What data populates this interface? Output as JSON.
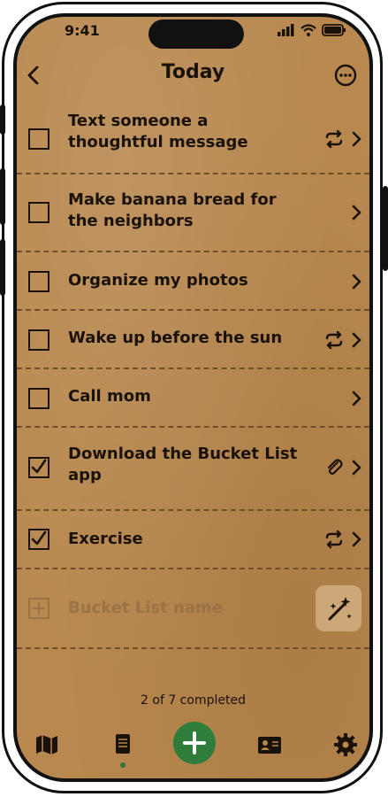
{
  "status_bar": {
    "time": "9:41"
  },
  "header": {
    "title": "Today"
  },
  "tasks": [
    {
      "label": "Text someone a thoughtful message",
      "checked": false,
      "icons": [
        "repeat-icon",
        "chevron-right-icon"
      ]
    },
    {
      "label": "Make banana bread for the neighbors",
      "checked": false,
      "icons": [
        "chevron-right-icon"
      ]
    },
    {
      "label": "Organize my photos",
      "checked": false,
      "icons": [
        "chevron-right-icon"
      ]
    },
    {
      "label": "Wake up before the sun",
      "checked": false,
      "icons": [
        "repeat-icon",
        "chevron-right-icon"
      ]
    },
    {
      "label": "Call mom",
      "checked": false,
      "icons": [
        "chevron-right-icon"
      ]
    },
    {
      "label": "Download the Bucket List app",
      "checked": true,
      "icons": [
        "paperclip-icon",
        "chevron-right-icon"
      ]
    },
    {
      "label": "Exercise",
      "checked": true,
      "icons": [
        "repeat-icon",
        "chevron-right-icon"
      ]
    }
  ],
  "add_row": {
    "placeholder": "Bucket List name"
  },
  "footer": {
    "completed_text": "2 of 7 completed"
  },
  "tabbar": {
    "items": [
      "map-icon",
      "list-icon",
      "add-icon",
      "contact-card-icon",
      "gear-icon"
    ],
    "active": "list-icon"
  },
  "colors": {
    "background": "#b8884f",
    "text": "#1a1208",
    "accent": "#2f7d3b",
    "placeholder": "#9a7347"
  }
}
